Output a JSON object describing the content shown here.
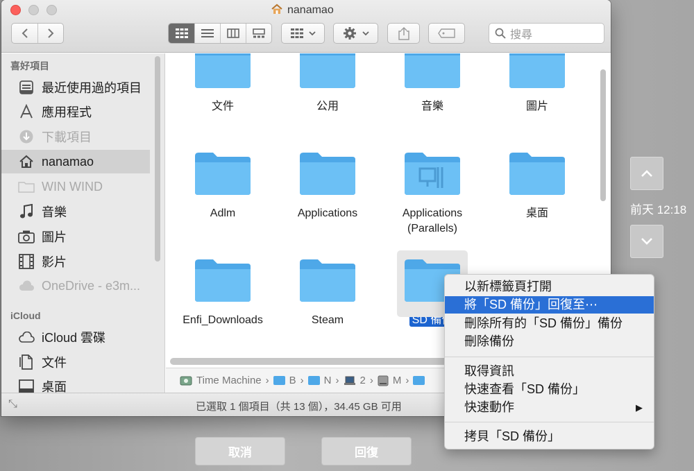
{
  "window": {
    "title": "nanamao"
  },
  "search": {
    "placeholder": "搜尋"
  },
  "sidebar": {
    "favorites_header": "喜好項目",
    "favorites": [
      {
        "label": "最近使用過的項目",
        "icon": "recents-icon"
      },
      {
        "label": "應用程式",
        "icon": "applications-icon"
      },
      {
        "label": "下載項目",
        "icon": "downloads-icon"
      },
      {
        "label": "nanamao",
        "icon": "home-icon"
      },
      {
        "label": "WIN WIND",
        "icon": "folder-icon"
      },
      {
        "label": "音樂",
        "icon": "music-icon"
      },
      {
        "label": "圖片",
        "icon": "camera-icon"
      },
      {
        "label": "影片",
        "icon": "film-icon"
      },
      {
        "label": "OneDrive - e3m...",
        "icon": "cloud-icon"
      }
    ],
    "icloud_header": "iCloud",
    "icloud": [
      {
        "label": "iCloud 雲碟",
        "icon": "cloud-icon"
      },
      {
        "label": "文件",
        "icon": "document-icon"
      },
      {
        "label": "桌面",
        "icon": "desktop-icon"
      }
    ]
  },
  "files": [
    {
      "label": "文件"
    },
    {
      "label": "公用"
    },
    {
      "label": "音樂"
    },
    {
      "label": "圖片"
    },
    {
      "label": "Adlm"
    },
    {
      "label": "Applications"
    },
    {
      "label": "Applications\n(Parallels)"
    },
    {
      "label": "桌面"
    },
    {
      "label": "Enfi_Downloads"
    },
    {
      "label": "Steam"
    },
    {
      "label": "SD 備份"
    }
  ],
  "pathbar": {
    "items": [
      "Time Machine",
      "B",
      "N",
      "2",
      "M"
    ]
  },
  "status": {
    "text": "已選取 1 個項目（共 13 個），34.45 GB 可用"
  },
  "buttons": {
    "cancel": "取消",
    "restore": "回復"
  },
  "timemachine": {
    "time": "前天 12:18"
  },
  "menu": {
    "group1": [
      "以新標籤頁打開",
      "將「SD 備份」回復至⋯",
      "刪除所有的「SD 備份」備份",
      "刪除備份"
    ],
    "group2": [
      "取得資訊",
      "快速查看「SD 備份」",
      "快速動作"
    ],
    "group3": [
      "拷貝「SD 備份」"
    ]
  },
  "colors": {
    "folder": "#5cb8f0",
    "selection": "#2a6fd6",
    "close": "#fc605c"
  }
}
